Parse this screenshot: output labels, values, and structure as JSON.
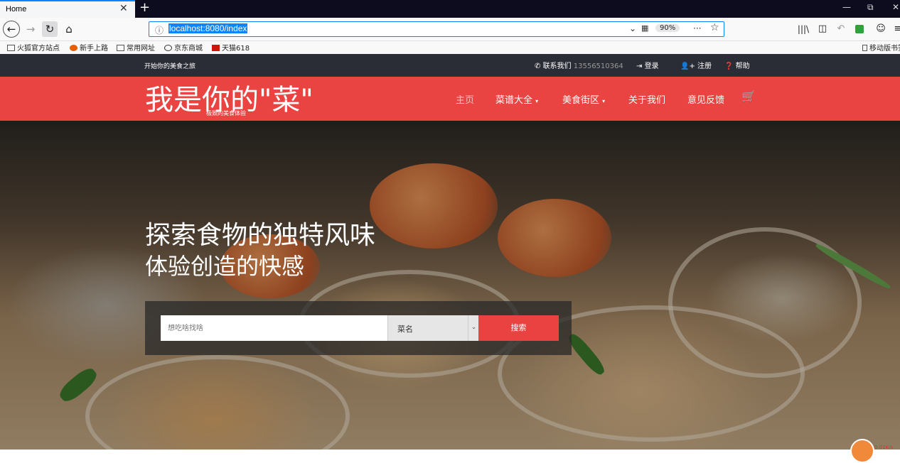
{
  "tab": {
    "title": "Home"
  },
  "window": {
    "minimize": "—",
    "restore": "⧉",
    "close": "✕"
  },
  "nav": {
    "url": "localhost:8080/index",
    "zoom": "90%",
    "more": "···"
  },
  "bookmarks": [
    {
      "label": "火狐官方站点"
    },
    {
      "label": "新手上路"
    },
    {
      "label": "常用网址"
    },
    {
      "label": "京东商城"
    },
    {
      "label": "天猫618"
    }
  ],
  "bookmarks_right": "移动版书签",
  "site": {
    "slogan": "开始你的美食之旅",
    "contact_label": "联系我们",
    "phone": "13556510364",
    "login": "登录",
    "register": "注册",
    "help": "帮助",
    "logo": "我是你的\"菜\"",
    "logo_sub": "极致的美食体验",
    "menu": {
      "home": "主页",
      "recipes": "菜谱大全",
      "food_street": "美食街区",
      "about": "关于我们",
      "feedback": "意见反馈"
    },
    "hero": {
      "line1": "探索食物的独特风味",
      "line2": "体验创造的快感"
    },
    "search": {
      "placeholder": "想吃啥找啥",
      "select_value": "菜名",
      "button": "搜索"
    }
  },
  "status": {
    "speed": "0.01K/s"
  },
  "colors": {
    "accent_red": "#e94442",
    "topbar": "#2a2d35",
    "firefox_blue": "#0a84ff"
  }
}
